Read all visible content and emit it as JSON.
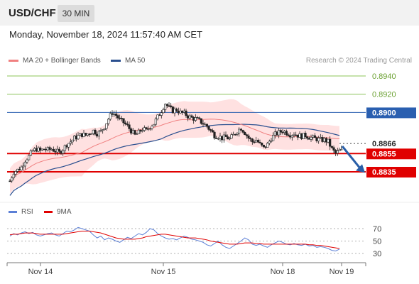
{
  "header": {
    "pair": "USD/CHF",
    "timeframe": "30 MIN"
  },
  "datetime": "Monday, November 18, 2024 11:57:40 AM CET",
  "legend": {
    "bollinger": {
      "label": "MA 20 + Bollinger Bands",
      "color": "#f08080"
    },
    "ma50": {
      "label": "MA 50",
      "color": "#2a4f8f"
    }
  },
  "credit": "Research © 2024 Trading Central",
  "indicator_legend": {
    "rsi": {
      "label": "RSI",
      "color": "#5b7fd6"
    },
    "ma9": {
      "label": "9MA",
      "color": "#e00000"
    }
  },
  "chart_data": {
    "type": "candlestick",
    "price_range": [
      0.881,
      0.895
    ],
    "levels": [
      {
        "value": 0.894,
        "label": "0.8940",
        "style": "green-line"
      },
      {
        "value": 0.892,
        "label": "0.8920",
        "style": "green-line"
      },
      {
        "value": 0.89,
        "label": "0.8900",
        "style": "blue-box"
      },
      {
        "value": 0.8866,
        "label": "0.8866",
        "style": "current-price"
      },
      {
        "value": 0.8855,
        "label": "0.8855",
        "style": "red-box"
      },
      {
        "value": 0.8835,
        "label": "0.8835",
        "style": "red-box"
      }
    ],
    "x_labels": [
      "Nov 14",
      "Nov 15",
      "Nov 18",
      "Nov 19"
    ],
    "close_path": [
      0.8825,
      0.8835,
      0.8837,
      0.884,
      0.8848,
      0.8852,
      0.8858,
      0.886,
      0.8858,
      0.886,
      0.8859,
      0.886,
      0.8858,
      0.8856,
      0.886,
      0.8865,
      0.8868,
      0.8872,
      0.8874,
      0.8876,
      0.8875,
      0.8878,
      0.888,
      0.8877,
      0.8879,
      0.8885,
      0.8893,
      0.89,
      0.8897,
      0.8892,
      0.8889,
      0.8885,
      0.888,
      0.8875,
      0.8878,
      0.8882,
      0.888,
      0.8885,
      0.8888,
      0.8895,
      0.8902,
      0.891,
      0.8905,
      0.8902,
      0.8903,
      0.89,
      0.8899,
      0.8896,
      0.8894,
      0.8893,
      0.8891,
      0.8888,
      0.8885,
      0.888,
      0.8875,
      0.8874,
      0.8872,
      0.8873,
      0.8871,
      0.8875,
      0.888,
      0.8883,
      0.8878,
      0.8872,
      0.8868,
      0.887,
      0.8865,
      0.8861,
      0.8865,
      0.8872,
      0.8876,
      0.8878,
      0.888,
      0.8878,
      0.8876,
      0.8877,
      0.8875,
      0.8874,
      0.8875,
      0.8873,
      0.8872,
      0.8871,
      0.887,
      0.887,
      0.8868,
      0.886,
      0.8855,
      0.8858
    ],
    "rsi": {
      "ticks": [
        70,
        50,
        30
      ],
      "values": [
        58,
        62,
        60,
        63,
        65,
        62,
        64,
        60,
        58,
        60,
        62,
        63,
        60,
        58,
        62,
        66,
        65,
        68,
        72,
        70,
        68,
        66,
        60,
        55,
        58,
        52,
        55,
        53,
        50,
        48,
        52,
        56,
        54,
        58,
        62,
        60,
        64,
        70,
        68,
        62,
        58,
        55,
        53,
        54,
        52,
        55,
        58,
        56,
        53,
        52,
        50,
        48,
        44,
        42,
        46,
        50,
        44,
        40,
        38,
        42,
        46,
        50,
        55,
        52,
        45,
        43,
        45,
        42,
        40,
        44,
        47,
        50,
        48,
        45,
        44,
        46,
        44,
        43,
        45,
        42,
        43,
        40,
        41,
        40,
        38,
        35,
        34,
        37
      ],
      "ma9": [
        60,
        61,
        61,
        62,
        63,
        63,
        63,
        62,
        61,
        61,
        61,
        61,
        61,
        61,
        61,
        62,
        63,
        64,
        65,
        66,
        66,
        66,
        65,
        64,
        63,
        61,
        59,
        57,
        55,
        54,
        53,
        53,
        53,
        53,
        54,
        55,
        57,
        58,
        59,
        60,
        61,
        61,
        60,
        59,
        58,
        57,
        56,
        55,
        55,
        55,
        54,
        53,
        52,
        50,
        49,
        48,
        47,
        46,
        45,
        45,
        45,
        46,
        47,
        47,
        47,
        46,
        46,
        45,
        45,
        45,
        45,
        45,
        45,
        45,
        45,
        45,
        45,
        45,
        45,
        44,
        44,
        43,
        43,
        42,
        41,
        40,
        39,
        38
      ]
    }
  }
}
